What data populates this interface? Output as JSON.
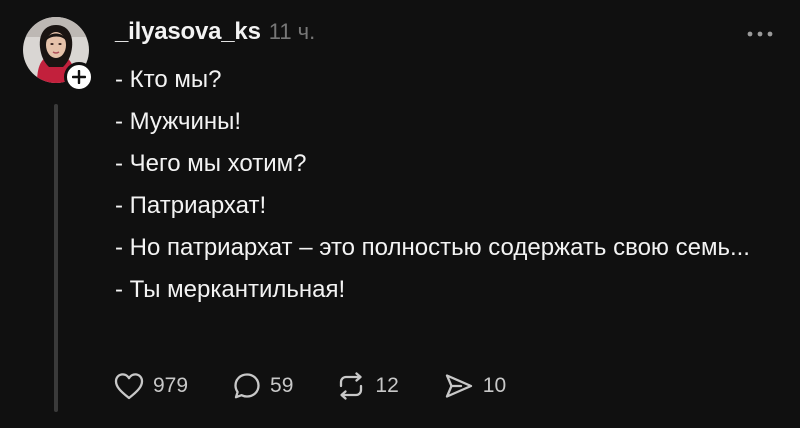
{
  "post": {
    "username": "_ilyasova_ks",
    "timestamp": "11 ч.",
    "lines": [
      "- Кто мы?",
      "- Мужчины!",
      "- Чего мы хотим?",
      "- Патриархат!",
      "- Но патриархат – это полностью содержать свою семь...",
      "- Ты меркантильная!"
    ]
  },
  "actions": {
    "likes": "979",
    "replies": "59",
    "reposts": "12",
    "shares": "10"
  },
  "icons": {
    "like": "heart-icon",
    "reply": "comment-bubble-icon",
    "repost": "repost-icon",
    "share": "send-icon",
    "more": "more-horizontal-icon",
    "follow": "plus-icon"
  },
  "colors": {
    "background": "#101010",
    "text": "#f3f3f3",
    "muted": "#777777",
    "icon": "#c8c8c8"
  }
}
